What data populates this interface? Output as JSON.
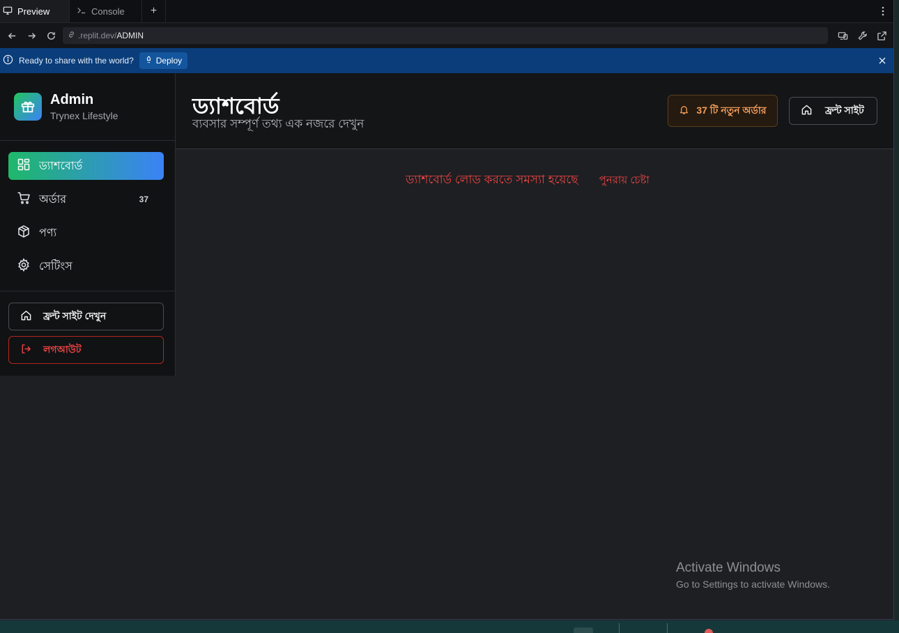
{
  "browser": {
    "tabs": [
      {
        "label": "Preview",
        "icon": "monitor-icon",
        "active": true
      },
      {
        "label": "Console",
        "icon": "terminal-icon",
        "active": false
      }
    ],
    "new_tab": "+",
    "url_domain": ".replit.dev/",
    "url_path": "ADMIN"
  },
  "banner": {
    "text": "Ready to share with the world?",
    "deploy_label": "Deploy"
  },
  "sidebar": {
    "brand_title": "Admin",
    "brand_sub": "Trynex Lifestyle",
    "items": [
      {
        "label": "ড্যাশবোর্ড",
        "icon": "dashboard-grid-icon",
        "active": true
      },
      {
        "label": "অর্ডার",
        "icon": "cart-icon",
        "count": "37"
      },
      {
        "label": "পণ্য",
        "icon": "box-icon"
      },
      {
        "label": "সেটিংস",
        "icon": "gear-icon"
      }
    ],
    "front_site_label": "ফ্রন্ট সাইট দেখুন",
    "logout_label": "লগআউট"
  },
  "header": {
    "title": "ড্যাশবোর্ড",
    "subtitle": "ব্যবসার সম্পূর্ণ তথ্য এক নজরে দেখুন",
    "orders_badge": "37 টি নতুন অর্ডার",
    "front_site": "ফ্রন্ট সাইট"
  },
  "main": {
    "error_message": "ড্যাশবোর্ড লোড করতে সমস্যা হয়েছে",
    "retry_label": "পুনরায় চেষ্টা"
  },
  "watermark": {
    "title": "Activate Windows",
    "subtitle": "Go to Settings to activate Windows."
  },
  "colors": {
    "accent_start": "#22c55e",
    "accent_end": "#3b82f6",
    "danger": "#ef4444",
    "warning": "#f59e5b",
    "banner": "#0a3d7a"
  }
}
